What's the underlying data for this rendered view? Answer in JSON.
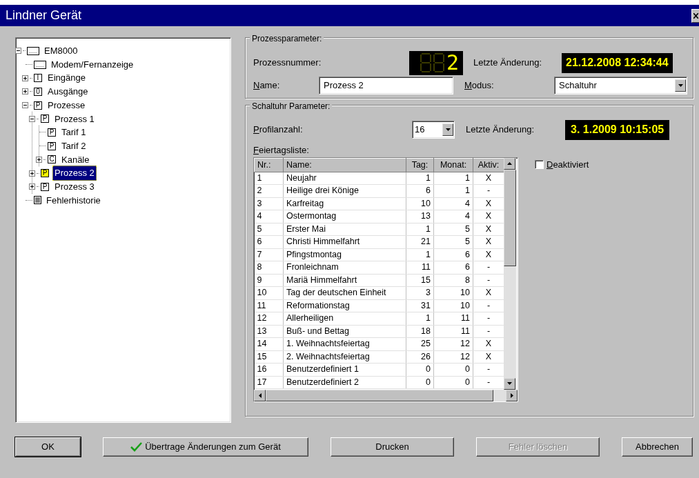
{
  "window": {
    "title": "Lindner Gerät"
  },
  "tree": [
    {
      "label": "EM8000",
      "kind": "screen",
      "expanded": true,
      "selected": false,
      "children": [
        {
          "label": "Modem/Fernanzeige",
          "kind": "screen",
          "selected": false
        },
        {
          "label": "Eingänge",
          "kind": "letter",
          "badge": "I",
          "expanded": false,
          "selected": false
        },
        {
          "label": "Ausgänge",
          "kind": "letter",
          "badge": "0",
          "expanded": false,
          "selected": false
        },
        {
          "label": "Prozesse",
          "kind": "letter",
          "badge": "P",
          "expanded": true,
          "selected": false,
          "children": [
            {
              "label": "Prozess 1",
              "kind": "letter",
              "badge": "P",
              "expanded": true,
              "selected": false,
              "children": [
                {
                  "label": "Tarif 1",
                  "kind": "letter",
                  "badge": "P",
                  "selected": false
                },
                {
                  "label": "Tarif 2",
                  "kind": "letter",
                  "badge": "P",
                  "selected": false
                },
                {
                  "label": "Kanäle",
                  "kind": "letter",
                  "badge": "C",
                  "expanded": false,
                  "selected": false
                }
              ]
            },
            {
              "label": "Prozess 2",
              "kind": "letter",
              "badge": "P",
              "expanded": false,
              "selected": true
            },
            {
              "label": "Prozess 3",
              "kind": "letter",
              "badge": "P",
              "expanded": false,
              "selected": false
            }
          ]
        },
        {
          "label": "Fehlerhistorie",
          "kind": "list",
          "selected": false
        }
      ]
    }
  ],
  "process_group": {
    "title": "Prozessparameter:",
    "number_label": "Prozessnummer:",
    "number_value": "2",
    "changed_label": "Letzte Änderung:",
    "changed_value": "21.12.2008 12:34:44",
    "name_label": "Name:",
    "name_value": "Prozess 2",
    "mode_label": "Modus:",
    "mode_value": "Schaltuhr"
  },
  "timer_group": {
    "title": "Schaltuhr Parameter:",
    "profiles_label": "Profilanzahl:",
    "profiles_value": "16",
    "changed_label": "Letzte Änderung:",
    "changed_value": "3. 1.2009 10:15:05",
    "list_label": "Feiertagsliste:",
    "disabled_checkbox": {
      "label": "Deaktiviert",
      "checked": false
    },
    "table": {
      "columns": [
        "Nr.:",
        "Name:",
        "Tag:",
        "Monat:",
        "Aktiv:"
      ],
      "rows": [
        [
          "1",
          "Neujahr",
          "1",
          "1",
          "X"
        ],
        [
          "2",
          "Heilige drei Könige",
          "6",
          "1",
          "-"
        ],
        [
          "3",
          "Karfreitag",
          "10",
          "4",
          "X"
        ],
        [
          "4",
          "Ostermontag",
          "13",
          "4",
          "X"
        ],
        [
          "5",
          "Erster Mai",
          "1",
          "5",
          "X"
        ],
        [
          "6",
          "Christi Himmelfahrt",
          "21",
          "5",
          "X"
        ],
        [
          "7",
          "Pfingstmontag",
          "1",
          "6",
          "X"
        ],
        [
          "8",
          "Fronleichnam",
          "11",
          "6",
          "-"
        ],
        [
          "9",
          "Mariä Himmelfahrt",
          "15",
          "8",
          "-"
        ],
        [
          "10",
          "Tag der deutschen Einheit",
          "3",
          "10",
          "X"
        ],
        [
          "11",
          "Reformationstag",
          "31",
          "10",
          "-"
        ],
        [
          "12",
          "Allerheiligen",
          "1",
          "11",
          "-"
        ],
        [
          "13",
          "Buß- und Bettag",
          "18",
          "11",
          "-"
        ],
        [
          "14",
          "1. Weihnachtsfeiertag",
          "25",
          "12",
          "X"
        ],
        [
          "15",
          "2. Weihnachtsfeiertag",
          "26",
          "12",
          "X"
        ],
        [
          "16",
          "Benutzerdefiniert 1",
          "0",
          "0",
          "-"
        ],
        [
          "17",
          "Benutzerdefiniert 2",
          "0",
          "0",
          "-"
        ]
      ]
    }
  },
  "buttons": [
    {
      "label": "OK",
      "default": true,
      "disabled": false
    },
    {
      "label": "Übertrage Änderungen zum Gerät",
      "kind": "check",
      "default": false,
      "disabled": false
    },
    {
      "label": "Drucken",
      "default": false,
      "disabled": false
    },
    {
      "label": "Fehler löschen",
      "default": false,
      "disabled": true
    },
    {
      "label": "Abbrechen",
      "default": false,
      "disabled": false
    }
  ]
}
